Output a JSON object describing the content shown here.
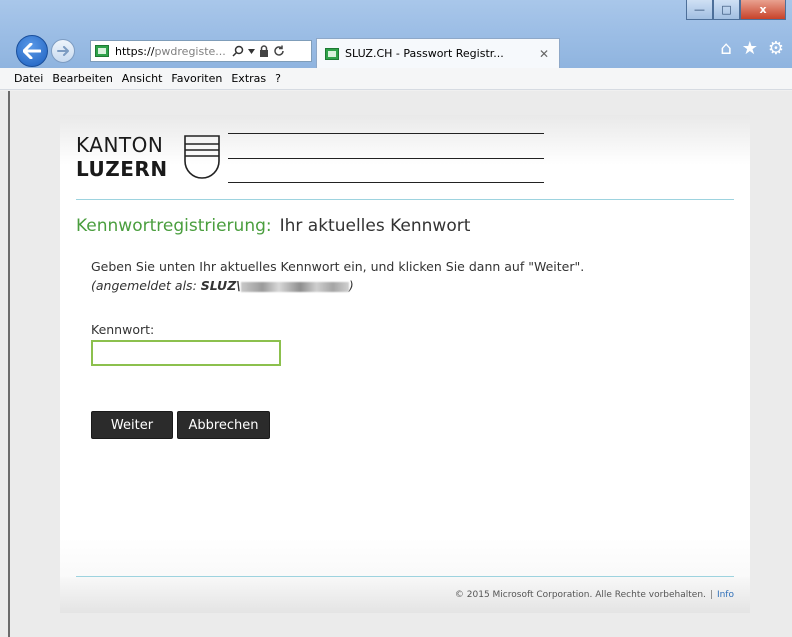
{
  "browser": {
    "address_https": "https://",
    "address_rest": "pwdregiste...",
    "tab_title": "SLUZ.CH - Passwort Registr...",
    "window_controls": {
      "minimize": "—",
      "maximize": "□",
      "close": "x"
    }
  },
  "menu": {
    "items": [
      "Datei",
      "Bearbeiten",
      "Ansicht",
      "Favoriten",
      "Extras",
      "?"
    ]
  },
  "logo": {
    "line1": "KANTON",
    "line2": "LUZERN"
  },
  "page": {
    "heading_part1": "Kennwortregistrierung:",
    "heading_part2": "Ihr aktuelles Kennwort",
    "instruction": "Geben Sie unten Ihr aktuelles Kennwort ein, und klicken Sie dann auf \"Weiter\".",
    "logged_in_prefix": "(angemeldet als: ",
    "logged_in_domain": "SLUZ\\",
    "logged_in_suffix": ")",
    "password_label": "Kennwort:",
    "password_value": "",
    "button_next": "Weiter",
    "button_cancel": "Abbrechen"
  },
  "footer": {
    "copyright": "© 2015 Microsoft Corporation. Alle Rechte vorbehalten.",
    "separator": "|",
    "info_link": "Info"
  },
  "colors": {
    "heading_green": "#4a9e3e",
    "input_border": "#8cc04d",
    "accent_line": "#9dd3df",
    "button_bg": "#2b2b2b",
    "link_blue": "#2f6fb8"
  }
}
